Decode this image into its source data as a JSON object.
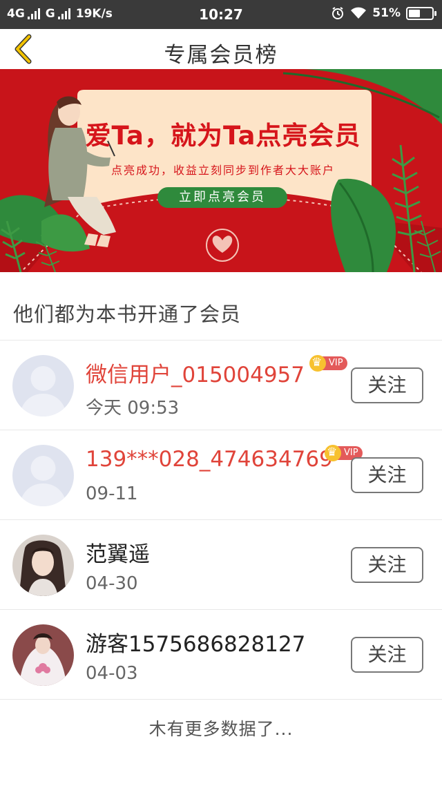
{
  "status_bar": {
    "network_1": "4G",
    "network_2": "G",
    "speed": "19K/s",
    "time": "10:27",
    "battery": "51%",
    "battery_level": 0.51,
    "icons": [
      "signal-icon",
      "alarm-icon",
      "wifi-icon",
      "battery-icon"
    ]
  },
  "nav": {
    "title": "专属会员榜",
    "back_icon": "chevron-left-icon",
    "accent_color": "#f2c200"
  },
  "banner": {
    "headline": "爱Ta，就为Ta点亮会员",
    "subtitle": "点亮成功，收益立刻同步到作者大大账户",
    "cta": "立即点亮会员",
    "colors": {
      "background": "#c8141a",
      "card": "#fde4c8",
      "button": "#2f8a3c"
    }
  },
  "section": {
    "title": "他们都为本书开通了会员"
  },
  "members": [
    {
      "name": "微信用户_015004957",
      "date": "今天 09:53",
      "vip": true,
      "vip_label": "VIP",
      "avatar": "default-avatar",
      "follow_label": "关注"
    },
    {
      "name": "139***028_474634769",
      "date": "09-11",
      "vip": true,
      "vip_label": "VIP",
      "avatar": "default-avatar",
      "follow_label": "关注"
    },
    {
      "name": "范翼遥",
      "date": "04-30",
      "vip": false,
      "avatar": "photo-avatar",
      "follow_label": "关注"
    },
    {
      "name": "游客1575686828127",
      "date": "04-03",
      "vip": false,
      "avatar": "photo-avatar",
      "follow_label": "关注"
    }
  ],
  "footer": {
    "text": "木有更多数据了..."
  },
  "colors": {
    "vip_name": "#e0443a",
    "status_bar": "#3a3a3a"
  }
}
